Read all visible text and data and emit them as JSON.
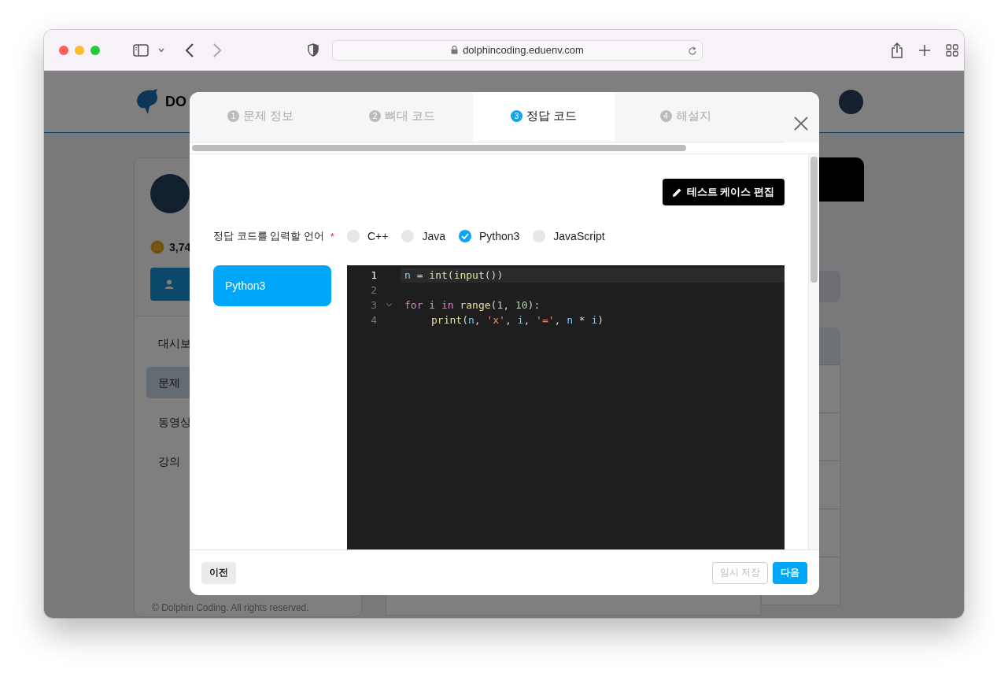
{
  "browser": {
    "url": "dolphincoding.eduenv.com"
  },
  "page": {
    "logo_text": "DO",
    "points": "3,74",
    "menu": [
      {
        "label": "대시보",
        "selected": false
      },
      {
        "label": "문제",
        "selected": true
      },
      {
        "label": "동영상",
        "selected": false
      },
      {
        "label": "강의",
        "selected": false
      }
    ],
    "footer": "© Dolphin Coding. All rights reserved."
  },
  "modal": {
    "tabs": [
      {
        "number": "1",
        "label": "문제 정보",
        "selected": false
      },
      {
        "number": "2",
        "label": "뼈대 코드",
        "selected": false
      },
      {
        "number": "3",
        "label": "정답 코드",
        "selected": true
      },
      {
        "number": "4",
        "label": "해설지",
        "selected": false
      }
    ],
    "edit_button": "테스트 케이스 편집",
    "language_label": "정답 코드를 입력할 언어",
    "required_mark": "*",
    "languages": [
      {
        "label": "C++",
        "checked": false
      },
      {
        "label": "Java",
        "checked": false
      },
      {
        "label": "Python3",
        "checked": true
      },
      {
        "label": "JavaScript",
        "checked": false
      }
    ],
    "code_tabs": [
      {
        "label": "Python3",
        "selected": true
      }
    ],
    "editor": {
      "lines": [
        {
          "number": "1",
          "active": true,
          "foldable": false,
          "tokens": [
            {
              "t": "n",
              "kind": "var"
            },
            {
              "t": " = ",
              "kind": "plain"
            },
            {
              "t": "int",
              "kind": "fn"
            },
            {
              "t": "(",
              "kind": "plain"
            },
            {
              "t": "input",
              "kind": "fn"
            },
            {
              "t": "())",
              "kind": "plain"
            }
          ]
        },
        {
          "number": "2",
          "active": false,
          "foldable": false
        },
        {
          "number": "3",
          "active": false,
          "foldable": true,
          "tokens": [
            {
              "t": "for ",
              "kind": "kw"
            },
            {
              "t": "i ",
              "kind": "var"
            },
            {
              "t": "in ",
              "kind": "kw"
            },
            {
              "t": "range",
              "kind": "fn"
            },
            {
              "t": "(",
              "kind": "plain"
            },
            {
              "t": "1",
              "kind": "num"
            },
            {
              "t": ", ",
              "kind": "plain"
            },
            {
              "t": "10",
              "kind": "num"
            },
            {
              "t": "):",
              "kind": "plain"
            }
          ]
        },
        {
          "number": "4",
          "active": false,
          "foldable": false,
          "indented": true,
          "tokens": [
            {
              "t": "print",
              "kind": "fn"
            },
            {
              "t": "(",
              "kind": "plain"
            },
            {
              "t": "n",
              "kind": "var"
            },
            {
              "t": ", ",
              "kind": "plain"
            },
            {
              "t": "'x'",
              "kind": "str"
            },
            {
              "t": ", ",
              "kind": "plain"
            },
            {
              "t": "i",
              "kind": "var"
            },
            {
              "t": ", ",
              "kind": "plain"
            },
            {
              "t": "'='",
              "kind": "str"
            },
            {
              "t": ", ",
              "kind": "plain"
            },
            {
              "t": "n",
              "kind": "var"
            },
            {
              "t": " * ",
              "kind": "plain"
            },
            {
              "t": "i",
              "kind": "var"
            },
            {
              "t": ")",
              "kind": "plain"
            }
          ]
        }
      ]
    },
    "footer": {
      "prev": "이전",
      "save": {
        "label": "임시 저장",
        "disabled": true
      },
      "next": "다음"
    }
  }
}
